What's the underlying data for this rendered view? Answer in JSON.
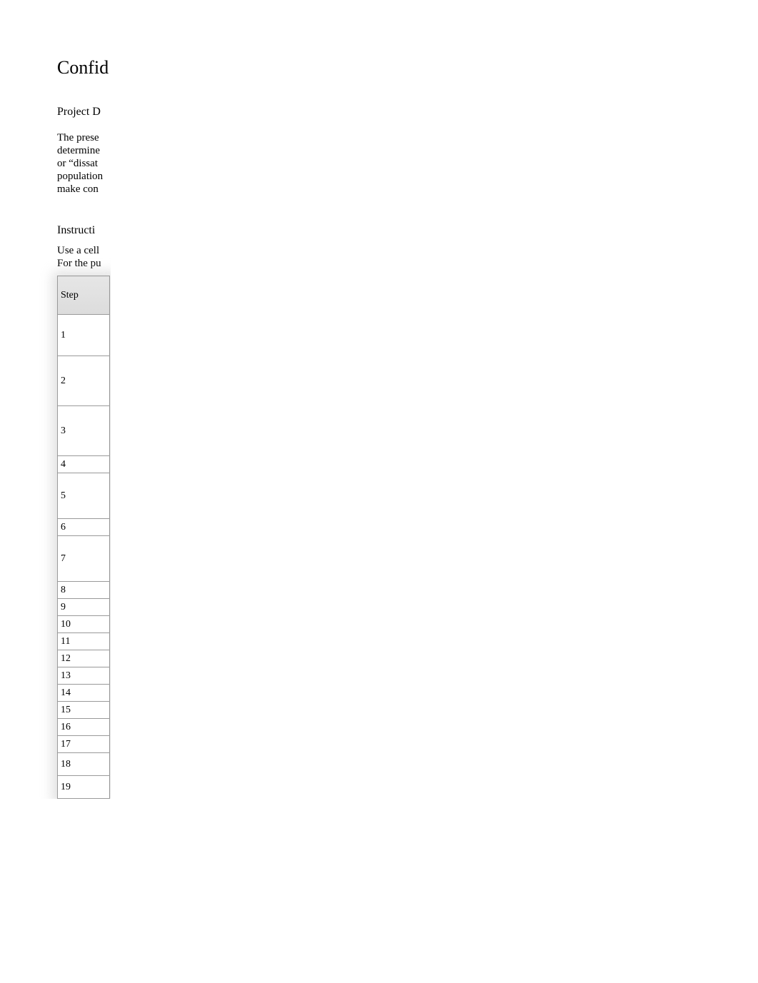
{
  "title": "Confid",
  "subtitle": "Project D",
  "paragraph": {
    "l1": "The prese",
    "l2": "determine",
    "l3": "or “dissat",
    "l4": "population",
    "l5": "make con"
  },
  "section_label": "Instructi",
  "note": {
    "l1": "Use a cell",
    "l2": "For the pu"
  },
  "table": {
    "header": "Step",
    "rows": [
      {
        "n": "1",
        "h": "row-lg"
      },
      {
        "n": "2",
        "h": "row-med"
      },
      {
        "n": "3",
        "h": "row-med"
      },
      {
        "n": "4",
        "h": "row-short"
      },
      {
        "n": "5",
        "h": "row-tall"
      },
      {
        "n": "6",
        "h": "row-short"
      },
      {
        "n": "7",
        "h": "row-tall"
      },
      {
        "n": "8",
        "h": "row-short"
      },
      {
        "n": "9",
        "h": "row-short"
      },
      {
        "n": "10",
        "h": "row-short"
      },
      {
        "n": "11",
        "h": "row-short"
      },
      {
        "n": "12",
        "h": "row-short"
      },
      {
        "n": "13",
        "h": "row-short"
      },
      {
        "n": "14",
        "h": "row-short"
      },
      {
        "n": "15",
        "h": "row-short"
      },
      {
        "n": "16",
        "h": "row-short"
      },
      {
        "n": "17",
        "h": "row-short"
      },
      {
        "n": "18",
        "h": "row-mid"
      },
      {
        "n": "19",
        "h": "row-mid"
      }
    ]
  }
}
